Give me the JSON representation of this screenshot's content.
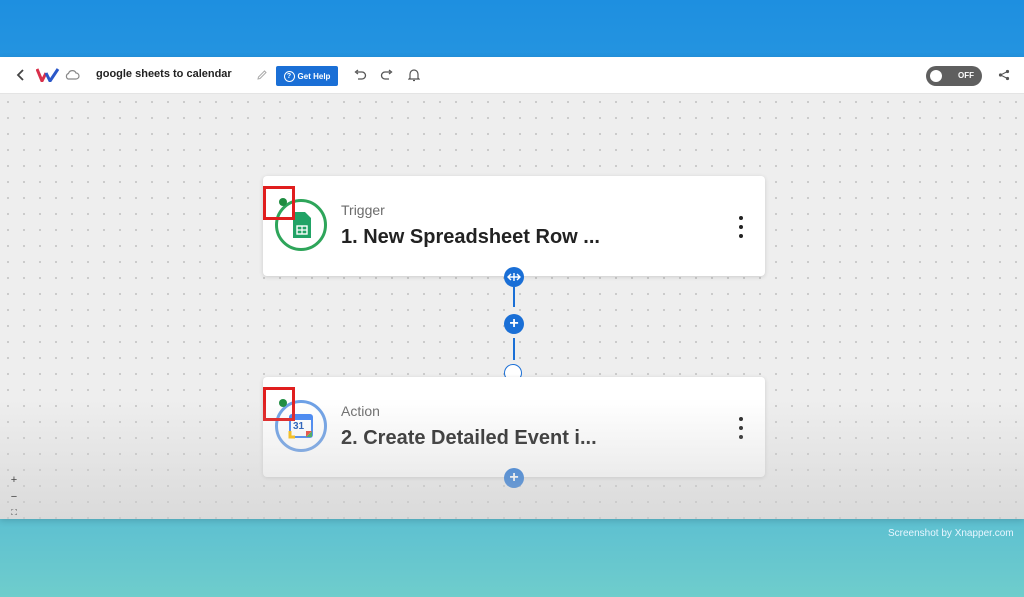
{
  "header": {
    "back_icon": "chevron-left-icon",
    "logo_icon": "app-logo",
    "cloud_icon": "cloud-icon",
    "title": "google sheets to calendar",
    "help_label": "Get Help",
    "toggle_label": "OFF",
    "accent": "#1a6fd6"
  },
  "workflow": {
    "steps": [
      {
        "type": "Trigger",
        "title": "1. New Spreadsheet Row ...",
        "app_icon": "google-sheets-icon",
        "ring_color": "#2ea55a"
      },
      {
        "type": "Action",
        "title": "2. Create Detailed Event i...",
        "app_icon": "google-calendar-icon",
        "ring_color": "#6b9fe6",
        "calendar_day": "31"
      }
    ]
  },
  "zoom": {
    "in": "+",
    "out": "−",
    "fit": "⛶"
  },
  "watermark": "Screenshot by Xnapper.com"
}
